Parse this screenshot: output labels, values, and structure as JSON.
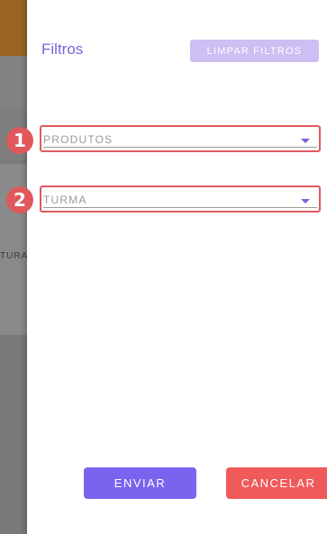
{
  "background": {
    "partial_text": "TURA",
    "colors": {
      "header": "#9a6520",
      "overlay": "#7a7a7a"
    }
  },
  "drawer": {
    "title": "Filtros",
    "clear_button_label": "LIMPAR FILTROS",
    "fields": [
      {
        "label": "PRODUTOS",
        "marker": "1"
      },
      {
        "label": "TURMA",
        "marker": "2"
      }
    ],
    "send_button_label": "ENVIAR",
    "cancel_button_label": "CANCELAR"
  },
  "colors": {
    "accent": "#7b63d6",
    "clear_button": "#cbbff3",
    "send_button": "#7b63f0",
    "cancel_button": "#f05a5a",
    "highlight_marker": "#e0585b"
  },
  "icons": {
    "dropdown": "caret-down-icon"
  }
}
